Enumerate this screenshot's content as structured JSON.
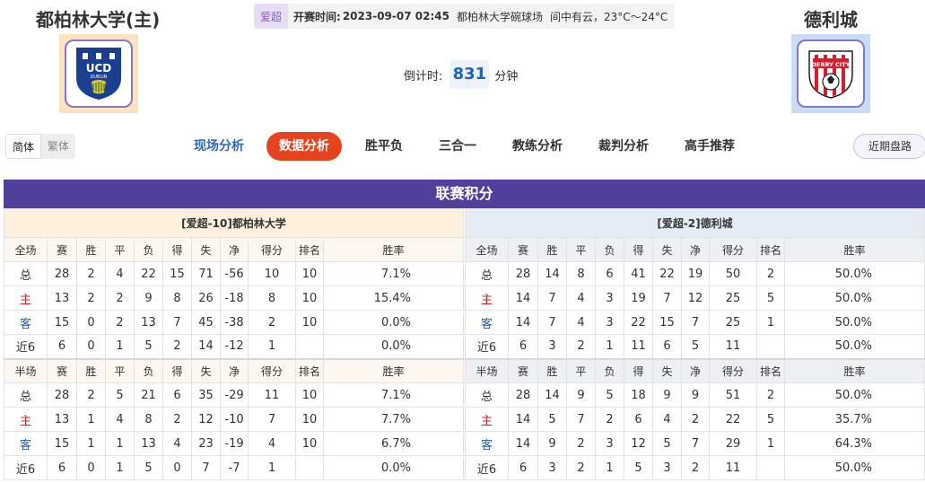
{
  "match": {
    "home_team": "都柏林大学(主)",
    "away_team": "德利城",
    "league": "爱超",
    "kickoff_label": "开赛时间:",
    "kickoff_time": "2023-09-07 02:45",
    "venue": "都柏林大学碗球场",
    "weather": "间中有云，",
    "temperature": "23°C～24°C",
    "countdown_label": "倒计时:",
    "countdown_value": "831",
    "countdown_unit": "分钟",
    "home_logo_text": "UCD",
    "away_logo_text": "DERRY CITY"
  },
  "lang": {
    "simplified": "简体",
    "traditional": "繁体"
  },
  "nav": {
    "items": [
      "现场分析",
      "数据分析",
      "胜平负",
      "三合一",
      "教练分析",
      "裁判分析",
      "高手推荐"
    ],
    "active": "数据分析",
    "recent": "近期盘路"
  },
  "standings": {
    "title": "联赛积分",
    "columns_full": [
      "全场",
      "赛",
      "胜",
      "平",
      "负",
      "得",
      "失",
      "净",
      "得分",
      "排名",
      "胜率"
    ],
    "columns_half": [
      "半场",
      "赛",
      "胜",
      "平",
      "负",
      "得",
      "失",
      "净",
      "得分",
      "排名",
      "胜率"
    ],
    "home": {
      "title": "[爱超-10]都柏林大学",
      "full": [
        [
          "总",
          "28",
          "2",
          "4",
          "22",
          "15",
          "71",
          "-56",
          "10",
          "10",
          "7.1%"
        ],
        [
          "主",
          "13",
          "2",
          "2",
          "9",
          "8",
          "26",
          "-18",
          "8",
          "10",
          "15.4%"
        ],
        [
          "客",
          "15",
          "0",
          "2",
          "13",
          "7",
          "45",
          "-38",
          "2",
          "10",
          "0.0%"
        ],
        [
          "近6",
          "6",
          "0",
          "1",
          "5",
          "2",
          "14",
          "-12",
          "1",
          "",
          "0.0%"
        ]
      ],
      "half": [
        [
          "总",
          "28",
          "2",
          "5",
          "21",
          "6",
          "35",
          "-29",
          "11",
          "10",
          "7.1%"
        ],
        [
          "主",
          "13",
          "1",
          "4",
          "8",
          "2",
          "12",
          "-10",
          "7",
          "10",
          "7.7%"
        ],
        [
          "客",
          "15",
          "1",
          "1",
          "13",
          "4",
          "23",
          "-19",
          "4",
          "10",
          "6.7%"
        ],
        [
          "近6",
          "6",
          "0",
          "1",
          "5",
          "0",
          "7",
          "-7",
          "1",
          "",
          "0.0%"
        ]
      ]
    },
    "away": {
      "title": "[爱超-2]德利城",
      "full": [
        [
          "总",
          "28",
          "14",
          "8",
          "6",
          "41",
          "22",
          "19",
          "50",
          "2",
          "50.0%"
        ],
        [
          "主",
          "14",
          "7",
          "4",
          "3",
          "19",
          "7",
          "12",
          "25",
          "5",
          "50.0%"
        ],
        [
          "客",
          "14",
          "7",
          "4",
          "3",
          "22",
          "15",
          "7",
          "25",
          "1",
          "50.0%"
        ],
        [
          "近6",
          "6",
          "3",
          "2",
          "1",
          "11",
          "6",
          "5",
          "11",
          "",
          "50.0%"
        ]
      ],
      "half": [
        [
          "总",
          "28",
          "14",
          "9",
          "5",
          "18",
          "9",
          "9",
          "51",
          "2",
          "50.0%"
        ],
        [
          "主",
          "14",
          "5",
          "7",
          "2",
          "6",
          "4",
          "2",
          "22",
          "5",
          "35.7%"
        ],
        [
          "客",
          "14",
          "9",
          "2",
          "3",
          "12",
          "5",
          "7",
          "29",
          "1",
          "64.3%"
        ],
        [
          "近6",
          "6",
          "3",
          "2",
          "1",
          "5",
          "3",
          "2",
          "11",
          "",
          "50.0%"
        ]
      ]
    }
  },
  "colors": {
    "header_purple": "#523f9b",
    "active_tab": "#e5431e",
    "home_red": "#d32020",
    "away_blue": "#1e5fb8",
    "countdown_blue": "#1a64c8"
  }
}
